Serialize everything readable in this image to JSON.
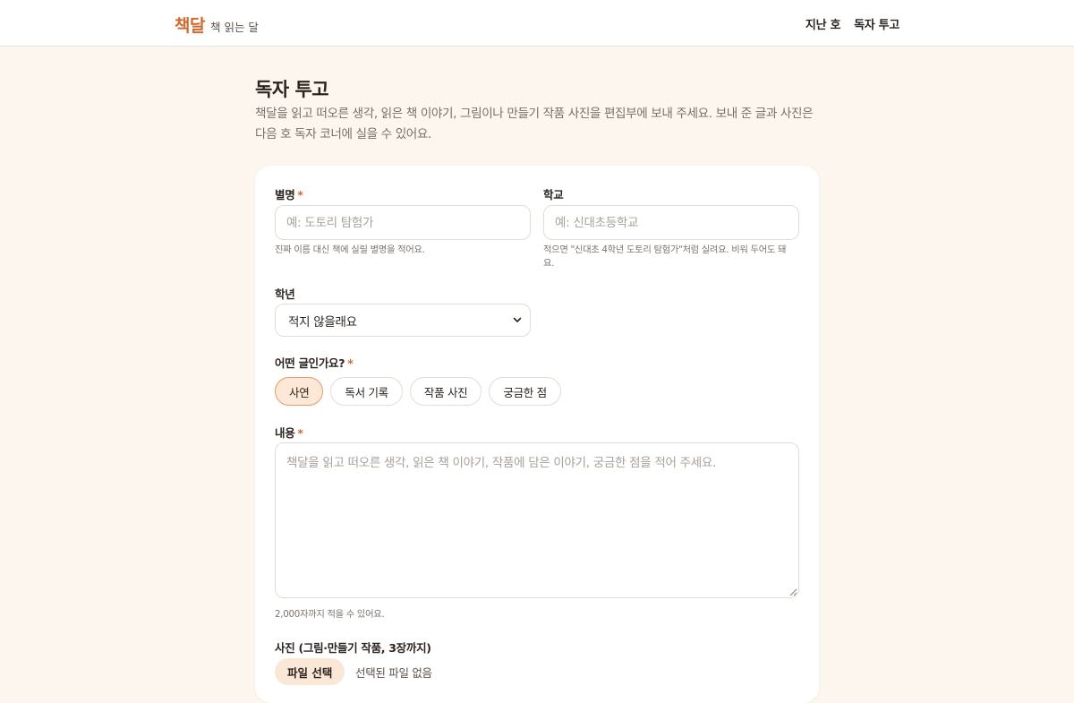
{
  "header": {
    "brand_name": "책달",
    "brand_tagline": "책 읽는 달",
    "nav": [
      "지난 호",
      "독자 투고"
    ]
  },
  "page": {
    "title": "독자 투고",
    "description": "책달을 읽고 떠오른 생각, 읽은 책 이야기, 그림이나 만들기 작품 사진을 편집부에 보내 주세요. 보내 준 글과 사진은 다음 호 독자 코너에 실을 수 있어요."
  },
  "form": {
    "nickname": {
      "label": "별명",
      "required_mark": "*",
      "value": "",
      "placeholder": "예: 도토리 탐험가",
      "hint": "진짜 이름 대신 책에 실릴 별명을 적어요."
    },
    "school": {
      "label": "학교",
      "value": "",
      "placeholder": "예: 신대초등학교",
      "hint": "적으면 \"신대초 4학년 도토리 탐험가\"처럼 실려요. 비워 두어도 돼요."
    },
    "grade": {
      "label": "학년",
      "selected": "적지 않을래요"
    },
    "type": {
      "label": "어떤 글인가요?",
      "required_mark": "*",
      "options": [
        "사연",
        "독서 기록",
        "작품 사진",
        "궁금한 점"
      ],
      "selected": "사연"
    },
    "content": {
      "label": "내용",
      "required_mark": "*",
      "value": "",
      "placeholder": "책달을 읽고 떠오른 생각, 읽은 책 이야기, 작품에 담은 이야기, 궁금한 점을 적어 주세요.",
      "hint": "2,000자까지 적을 수 있어요."
    },
    "photos": {
      "label": "사진 (그림·만들기 작품, 3장까지)",
      "button_label": "파일 선택",
      "status": "선택된 파일 없음"
    }
  },
  "colors": {
    "accent": "#d2692f",
    "background": "#fdf6ee",
    "chip_active_bg": "#fde7d6",
    "chip_active_border": "#e39a6b"
  }
}
